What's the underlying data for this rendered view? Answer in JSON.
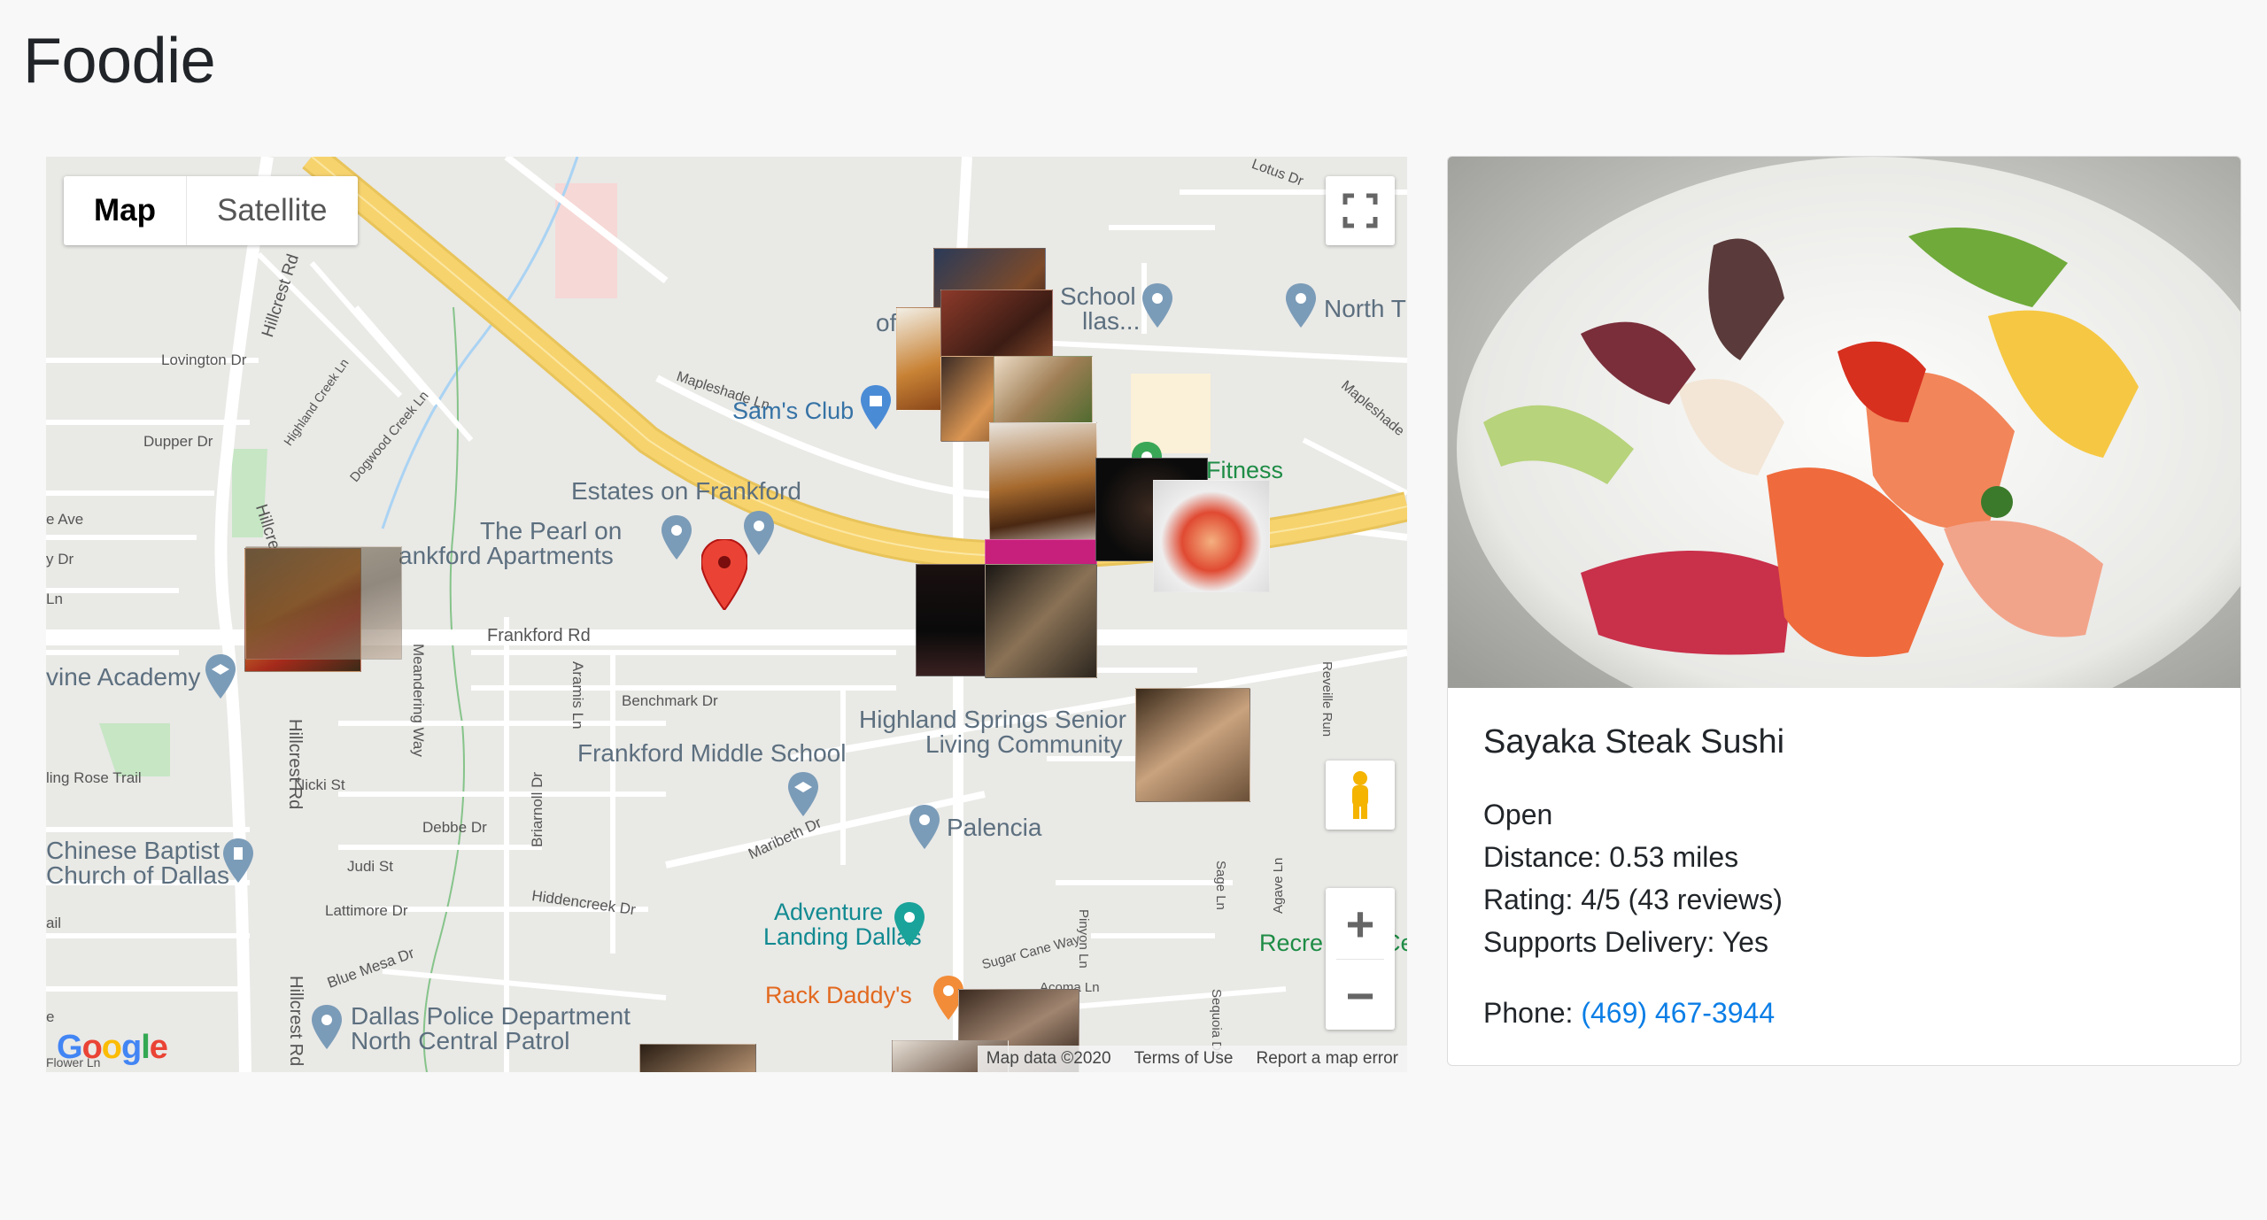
{
  "app": {
    "title": "Foodie"
  },
  "map": {
    "type_control": {
      "map_label": "Map",
      "satellite_label": "Satellite",
      "selected": "Map"
    },
    "labels": {
      "estates": "Estates on Frankford",
      "pearl_1": "The Pearl on",
      "pearl_2": "ankford Apartments",
      "sams": "Sam's Club",
      "school_1": "School",
      "school_2": "llas...",
      "of": "of",
      "north": "North T",
      "fitness": "Fitness",
      "irvine": "vine Academy",
      "highland_1": "Highland Springs Senior",
      "highland_2": "Living Community",
      "frankford_ms": "Frankford Middle School",
      "palencia": "Palencia",
      "chinese_1": "Chinese Baptist",
      "chinese_2": "Church of Dallas",
      "adventure_1": "Adventure",
      "adventure_2": "Landing Dallas",
      "rack": "Rack Daddy's",
      "police_1": "Dallas Police Department",
      "police_2": "North Central Patrol",
      "recre": "Recre",
      "ce": "Ce"
    },
    "streets": {
      "frankford": "Frankford Rd",
      "hillcrest_top": "Hillcrest Rd",
      "hillcrest_mid": "Hillcrest Rd",
      "hillcrest_bottom": "Hillcrest Rd",
      "hillcres": "Hillcres",
      "lovington": "Lovington Dr",
      "dupper": "Dupper Dr",
      "highland_creek": "Highland Creek Ln",
      "dogwood": "Dogwood Creek Ln",
      "mapleshade": "Mapleshade Ln",
      "mapleshade_right": "Mapleshade",
      "lotus": "Lotus Dr",
      "benchmark": "Benchmark Dr",
      "aramis": "Aramis Ln",
      "meandering": "Meandering Way",
      "nicki": "Nicki St",
      "debbe": "Debbe Dr",
      "briarnoll": "Briarnoll Dr",
      "judi": "Judi St",
      "lattimore": "Lattimore Dr",
      "hiddencreek": "Hiddencreek Dr",
      "maribeth": "Maribeth Dr",
      "blue_mesa": "Blue Mesa Dr",
      "sugar_cane": "Sugar Cane Way",
      "pinyon": "Pinyon Ln",
      "acoma": "Acoma Ln",
      "sage": "Sage Ln",
      "agave": "Agave Ln",
      "sequoia": "Sequoia Dr",
      "reveille": "Reveille Run",
      "rose_trail": "ling Rose Trail",
      "ave": "e Ave",
      "dr_left": "y Dr",
      "ln_left": "Ln",
      "ail": "ail",
      "e_left": "e",
      "flower": "Flower Ln"
    },
    "logo": "Google",
    "attribution": {
      "data": "Map data ©2020",
      "terms": "Terms of Use",
      "report": "Report a map error"
    },
    "controls": {
      "zoom_in": "+",
      "zoom_out": "−"
    }
  },
  "restaurant": {
    "name": "Sayaka Steak Sushi",
    "status": "Open",
    "distance": "Distance: 0.53 miles",
    "rating": "Rating: 4/5 (43 reviews)",
    "delivery": "Supports Delivery: Yes",
    "phone_label": "Phone: ",
    "phone": "(469) 467-3944"
  },
  "colors": {
    "accent": "#0b7ee6",
    "highway": "#f7d36e",
    "selected_pin": "#e53935",
    "poi_pin": "#7b9cb8"
  }
}
